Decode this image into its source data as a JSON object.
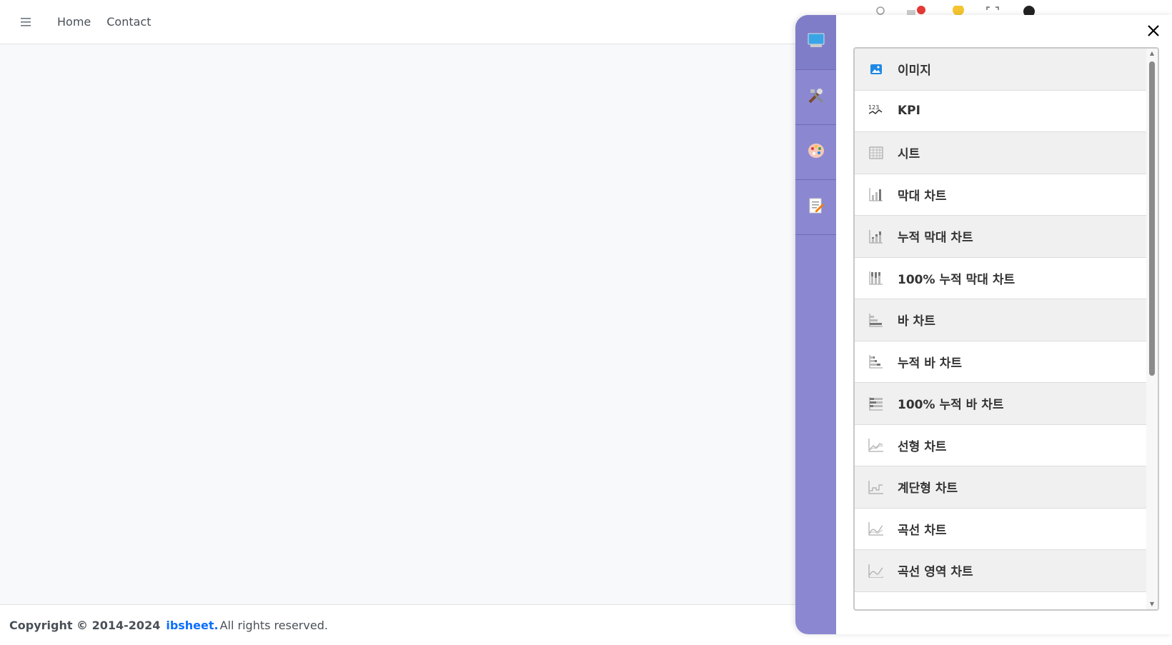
{
  "nav": {
    "links": [
      "Home",
      "Contact"
    ]
  },
  "footer": {
    "copyright": "Copyright © 2014-2024",
    "brand": "ibsheet.",
    "rest": "All rights reserved."
  },
  "panel": {
    "rail_tabs": [
      {
        "icon": "monitor-icon"
      },
      {
        "icon": "tools-icon"
      },
      {
        "icon": "palette-icon"
      },
      {
        "icon": "edit-document-icon"
      }
    ],
    "items": [
      {
        "label": "이미지",
        "icon": "image-icon"
      },
      {
        "label": "KPI",
        "icon": "kpi-icon"
      },
      {
        "label": "시트",
        "icon": "sheet-icon"
      },
      {
        "label": "막대 차트",
        "icon": "column-chart-icon"
      },
      {
        "label": "누적 막대 차트",
        "icon": "stacked-column-chart-icon"
      },
      {
        "label": "100% 누적 막대 차트",
        "icon": "stacked-100-column-chart-icon"
      },
      {
        "label": "바 차트",
        "icon": "bar-chart-icon"
      },
      {
        "label": "누적 바 차트",
        "icon": "stacked-bar-chart-icon"
      },
      {
        "label": "100% 누적 바 차트",
        "icon": "stacked-100-bar-chart-icon"
      },
      {
        "label": "선형 차트",
        "icon": "line-chart-icon"
      },
      {
        "label": "계단형 차트",
        "icon": "step-chart-icon"
      },
      {
        "label": "곡선 차트",
        "icon": "spline-chart-icon"
      },
      {
        "label": "곡선 영역 차트",
        "icon": "spline-area-chart-icon"
      }
    ]
  },
  "colors": {
    "rail": "#8b88d1",
    "brand": "#0d6efd"
  }
}
